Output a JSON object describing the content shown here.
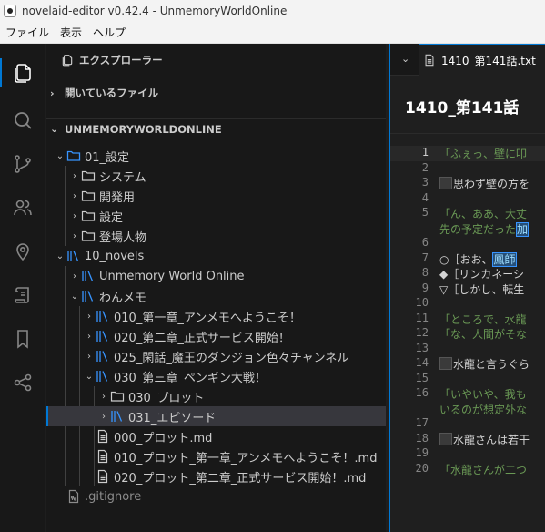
{
  "window": {
    "title": "novelaid-editor v0.42.4 - UnmemoryWorldOnline"
  },
  "menu": {
    "items": [
      "ファイル",
      "表示",
      "ヘルプ"
    ]
  },
  "sidebar": {
    "title": "エクスプローラー",
    "open_files_label": "開いているファイル",
    "workspace_label": "UNMEMORYWORLDONLINE",
    "tree": {
      "settings_folder": "01_設定",
      "system": "システム",
      "dev": "開発用",
      "config": "設定",
      "characters": "登場人物",
      "novels": "10_novels",
      "unmemory": "Unmemory World Online",
      "wanmemo": "わんメモ",
      "ch1": "010_第一章_アンメモへようこそ！",
      "ch2": "020_第二章_正式サービス開始！",
      "interlude": "025_閑話_魔王のダンジョン色々チャンネル",
      "ch3": "030_第三章_ペンギン大戦！",
      "plot_folder": "030_プロット",
      "episode_folder": "031_エピソード",
      "plot_md": "000_プロット.md",
      "plot_ch1": "010_プロット_第一章_アンメモへようこそ！.md",
      "plot_ch2": "020_プロット_第二章_正式サービス開始！.md",
      "gitignore": ".gitignore"
    }
  },
  "editor": {
    "tab_label": "1410_第141話.txt",
    "doc_title": "1410_第141話",
    "line_numbers": [
      "1",
      "2",
      "3",
      "4",
      "5",
      "",
      "6",
      "7",
      "8",
      "9",
      "10",
      "11",
      "12",
      "13",
      "14",
      "15",
      "16",
      "",
      "17",
      "18",
      "19",
      "20"
    ],
    "lines": {
      "l1": "「ふぇっ、壁に叩",
      "l3": "思わず壁の方を",
      "l5a": "「ん、ああ、大丈",
      "l5b": "先の予定だった",
      "l5b_hl": "加",
      "l7_pre": "○［おお、",
      "l7_hl": "鳳師",
      "l8": "◆［リンカネーシ",
      "l9": "▽［しかし、転生",
      "l11": "「ところで、水龍",
      "l12": "「な、人間がそな",
      "l14": "水龍と言うぐら",
      "l16a": "「いやいや、我も",
      "l16b": "いるのが想定外な",
      "l18": "水龍さんは若干",
      "l20": "「水龍さんが二つ"
    }
  },
  "colors": {
    "accent": "#0078d4",
    "speech": "#6a9955"
  }
}
